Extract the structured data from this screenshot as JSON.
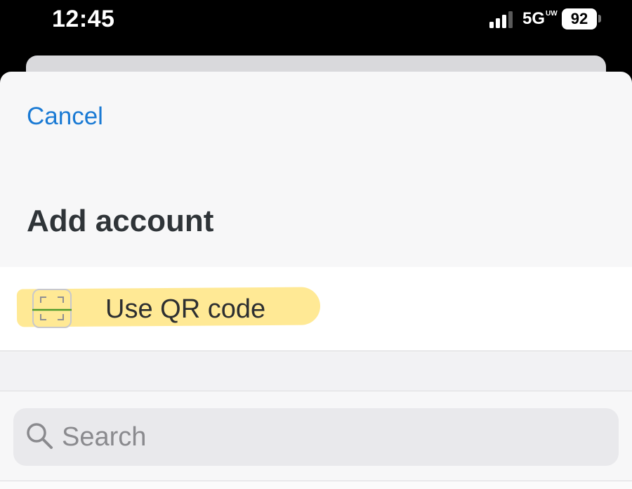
{
  "status_bar": {
    "time": "12:45",
    "network": "5G",
    "network_superscript": "UW",
    "battery": "92",
    "signal_icon": "cellular-signal-icon"
  },
  "sheet": {
    "cancel_label": "Cancel",
    "title": "Add account",
    "qr_option": {
      "label": "Use QR code",
      "icon": "qr-scan-icon"
    },
    "search": {
      "placeholder": "Search",
      "value": "",
      "icon": "search-icon"
    }
  },
  "colors": {
    "accent": "#1a7ad4",
    "highlight": "#ffe582",
    "sheet_bg": "#f7f7f8",
    "search_bg": "#e9e9ec"
  }
}
